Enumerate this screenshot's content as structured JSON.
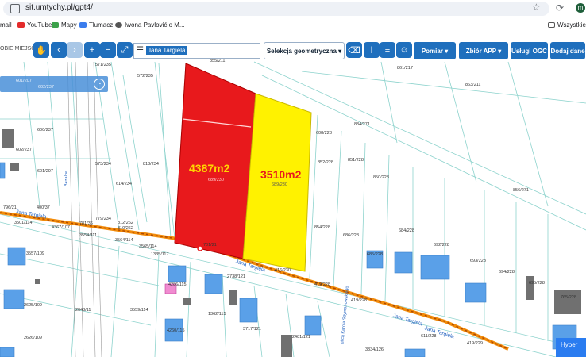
{
  "browser": {
    "url": "sit.umtychy.pl/gpt4/",
    "bookmarks": [
      "mail",
      "YouTube",
      "Mapy",
      "Tłumacz",
      "Iwona Pavlović o M...",
      "Wszystkie z"
    ]
  },
  "toolbar": {
    "miejsce_label": "OBIE MIEJSCE",
    "search_value": "Jana Targiela",
    "selection_label": "Selekcja geometryczna",
    "pomiar_label": "Pomiar",
    "zbior_label": "Zbiór APP",
    "uslugi_label": "Usługi OGC",
    "dodaj_label": "Dodaj dane"
  },
  "layer_panel": {
    "labels": [
      "601/207",
      "602/237"
    ]
  },
  "parcels": {
    "red": {
      "area": "4387m2",
      "id": "689/230",
      "color": "#e8191c"
    },
    "yellow": {
      "area": "3510m2",
      "id": "689/230",
      "color": "#fff200"
    },
    "labels": [
      "855/211",
      "571/235",
      "572/235",
      "861/217",
      "863/211",
      "834/271",
      "608/228",
      "600/237",
      "602/237",
      "601/207",
      "573/234",
      "813/234",
      "614/234",
      "852/228",
      "851/228",
      "850/228",
      "856/271",
      "854/228",
      "684/228",
      "692/228",
      "693/228",
      "694/228",
      "686/228",
      "685/228",
      "695/228",
      "779/234",
      "781/36",
      "810/262",
      "812/262",
      "3564/114",
      "3565/114",
      "1335/117",
      "3554/111",
      "2738/121",
      "416/230",
      "419/228",
      "419/229",
      "3559/114",
      "4286/115",
      "1362/115",
      "4260/115",
      "3717/121",
      "2625/109",
      "2626/109",
      "2048/11",
      "3557/109",
      "2481/121",
      "3334/126",
      "3501/114",
      "4367/107",
      "796/21",
      "400/37",
      "701/21",
      "611/228",
      "419/228",
      "765/228"
    ],
    "streets": [
      "Jana Targiela",
      "Jana Targiela",
      "Jana Targiela",
      "Jana Targiela",
      "ulica Karola Szymanowskiego",
      "Bezalna"
    ]
  },
  "map_colors": {
    "road": "#f28c0b",
    "building": "#5aa0e8",
    "grey_building": "#7a7a7a",
    "line": "#7fcdc7"
  },
  "corner_button": "Hyper"
}
